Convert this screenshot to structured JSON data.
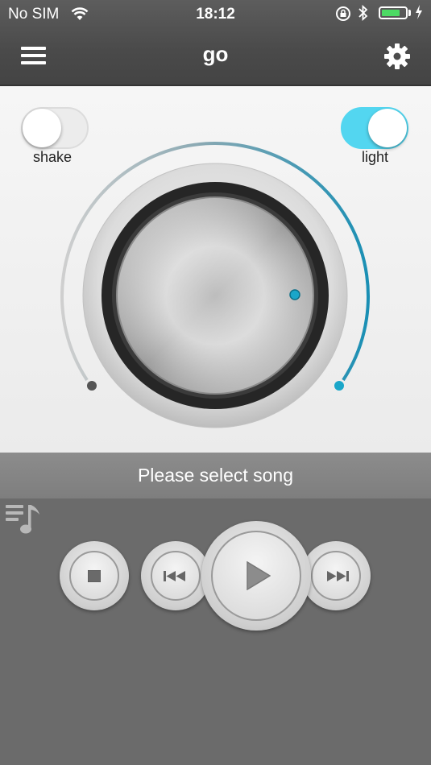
{
  "status": {
    "carrier": "No SIM",
    "time": "18:12",
    "battery_level": 0.8,
    "icons": [
      "wifi-icon",
      "rotation-lock-icon",
      "bluetooth-icon",
      "battery-icon",
      "charging-icon"
    ]
  },
  "header": {
    "title": "go",
    "menu_icon": "hamburger-menu-icon",
    "settings_icon": "gear-icon"
  },
  "toggles": {
    "shake": {
      "label": "shake",
      "on": false
    },
    "light": {
      "label": "light",
      "on": true
    }
  },
  "dial": {
    "level": 1.0,
    "min_dot_color": "#555555",
    "max_dot_color": "#1aa6c9",
    "arc_color": "#1a8fb4"
  },
  "song": {
    "status_text": "Please select song"
  },
  "player": {
    "playlist_icon": "playlist-music-icon",
    "buttons": [
      "stop-icon",
      "previous-icon",
      "play-icon",
      "next-icon"
    ]
  },
  "colors": {
    "accent": "#53d6f0",
    "battery": "#4cd964"
  }
}
